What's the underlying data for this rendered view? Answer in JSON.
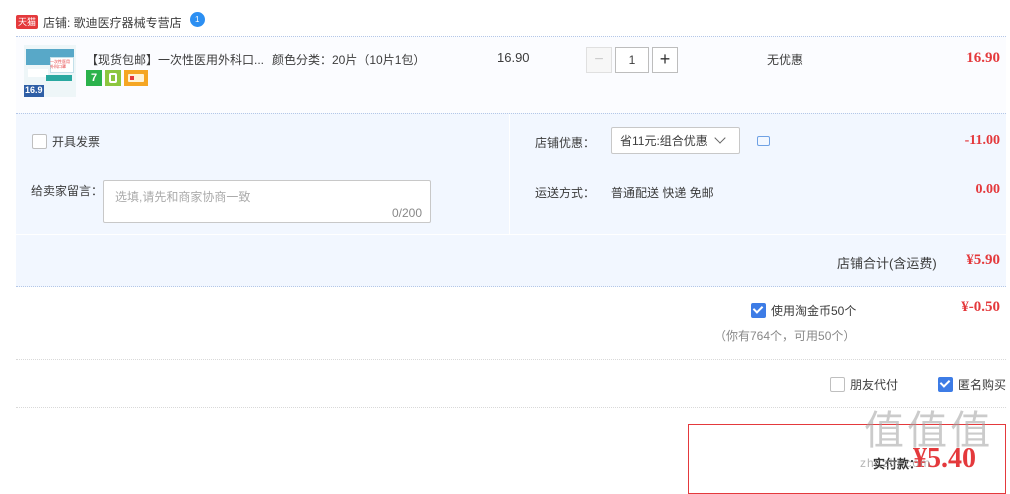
{
  "shop": {
    "tmall_badge": "天猫",
    "name": "店铺: 歌迪医疗器械专营店",
    "chat_badge": "1"
  },
  "item": {
    "thumb_price": "16.9",
    "thumb_text": "一次性医用外科口罩",
    "title": "【现货包邮】一次性医用外科口...",
    "sku": "颜色分类：20片（10片1包）",
    "unit_price": "16.90",
    "qty": "1",
    "minus": "−",
    "plus": "+",
    "promo": "无优惠",
    "subtotal": "16.90",
    "service_icon_7": "7"
  },
  "invoice": {
    "label": "开具发票",
    "checked": false
  },
  "shop_discount": {
    "label": "店铺优惠：",
    "selected": "省11元:组合优惠",
    "amount": "-11.00"
  },
  "message": {
    "label": "给卖家留言：",
    "placeholder": "选填,请先和商家协商一致",
    "counter": "0/200"
  },
  "shipping": {
    "label": "运送方式：",
    "value": "普通配送 快递 免邮",
    "amount": "0.00"
  },
  "shop_total": {
    "label": "店铺合计(含运费)",
    "amount": "¥5.90"
  },
  "coins": {
    "label": "使用淘金币50个",
    "note": "（你有764个，可用50个）",
    "amount": "¥-0.50",
    "checked": true
  },
  "options": {
    "friend_pay": "朋友代付",
    "anonymous": "匿名购买"
  },
  "payment": {
    "label": "实付款：",
    "amount": "¥5.40"
  },
  "watermark": {
    "text": "值 值 值",
    "site": "zhi.zhi.com"
  }
}
